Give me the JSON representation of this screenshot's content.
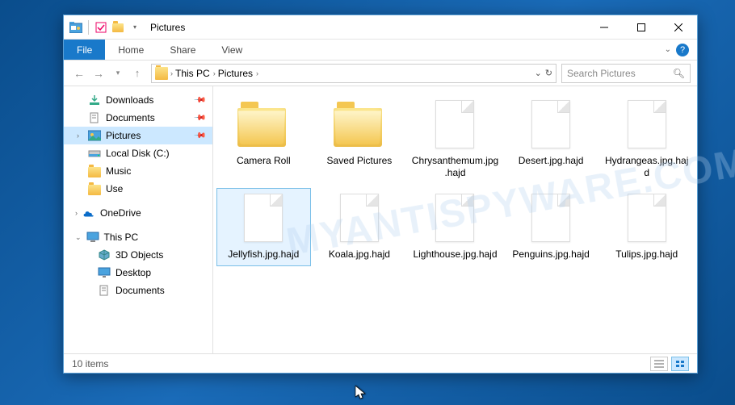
{
  "window": {
    "title": "Pictures"
  },
  "ribbon": {
    "file": "File",
    "home": "Home",
    "share": "Share",
    "view": "View"
  },
  "breadcrumb": {
    "seg1": "This PC",
    "seg2": "Pictures"
  },
  "search": {
    "placeholder": "Search Pictures"
  },
  "sidebar": {
    "downloads": "Downloads",
    "documents": "Documents",
    "pictures": "Pictures",
    "localdisk": "Local Disk (C:)",
    "music": "Music",
    "use": "Use",
    "onedrive": "OneDrive",
    "thispc": "This PC",
    "objects3d": "3D Objects",
    "desktop": "Desktop",
    "documents2": "Documents"
  },
  "items": {
    "i0": "Camera Roll",
    "i1": "Saved Pictures",
    "i2": "Chrysanthemum.jpg.hajd",
    "i3": "Desert.jpg.hajd",
    "i4": "Hydrangeas.jpg.hajd",
    "i5": "Jellyfish.jpg.hajd",
    "i6": "Koala.jpg.hajd",
    "i7": "Lighthouse.jpg.hajd",
    "i8": "Penguins.jpg.hajd",
    "i9": "Tulips.jpg.hajd"
  },
  "status": {
    "count": "10 items"
  }
}
